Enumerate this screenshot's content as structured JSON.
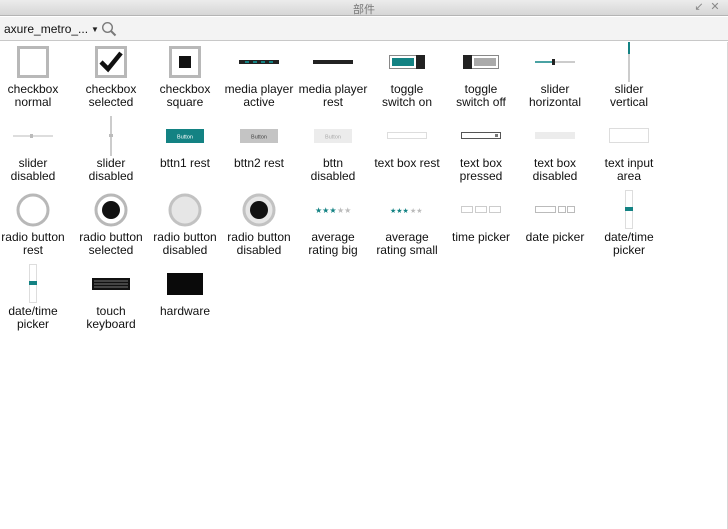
{
  "window": {
    "title": "部件"
  },
  "toolbar": {
    "library_select": "axure_metro_...",
    "search_icon": "search-icon"
  },
  "widgets": [
    {
      "id": "checkbox-normal",
      "line1": "checkbox",
      "line2": "normal"
    },
    {
      "id": "checkbox-selected",
      "line1": "checkbox",
      "line2": "selected"
    },
    {
      "id": "checkbox-square",
      "line1": "checkbox",
      "line2": "square"
    },
    {
      "id": "media-player-active",
      "line1": "media player",
      "line2": "active"
    },
    {
      "id": "media-player-rest",
      "line1": "media player",
      "line2": "rest"
    },
    {
      "id": "toggle-switch-on",
      "line1": "toggle",
      "line2": "switch on"
    },
    {
      "id": "toggle-switch-off",
      "line1": "toggle",
      "line2": "switch off"
    },
    {
      "id": "slider-horizontal",
      "line1": "slider",
      "line2": "horizontal"
    },
    {
      "id": "slider-vertical",
      "line1": "slider",
      "line2": "vertical"
    },
    {
      "id": "slider-disabled-h",
      "line1": "slider",
      "line2": "disabled"
    },
    {
      "id": "slider-disabled-v",
      "line1": "slider",
      "line2": "disabled"
    },
    {
      "id": "bttn1-rest",
      "line1": "bttn1 rest",
      "line2": "",
      "thumb_text": "Button"
    },
    {
      "id": "bttn2-rest",
      "line1": "bttn2 rest",
      "line2": "",
      "thumb_text": "Button"
    },
    {
      "id": "bttn-disabled",
      "line1": "bttn",
      "line2": "disabled",
      "thumb_text": "Button"
    },
    {
      "id": "text-box-rest",
      "line1": "text box rest",
      "line2": ""
    },
    {
      "id": "text-box-pressed",
      "line1": "text box",
      "line2": "pressed"
    },
    {
      "id": "text-box-disabled",
      "line1": "text box",
      "line2": "disabled"
    },
    {
      "id": "text-input-area",
      "line1": "text input",
      "line2": "area"
    },
    {
      "id": "radio-button-rest",
      "line1": "radio button",
      "line2": "rest"
    },
    {
      "id": "radio-button-selected",
      "line1": "radio button",
      "line2": "selected"
    },
    {
      "id": "radio-button-disabled",
      "line1": "radio button",
      "line2": "disabled"
    },
    {
      "id": "radio-button-disabled-selected",
      "line1": "radio button",
      "line2": "disabled"
    },
    {
      "id": "average-rating-big",
      "line1": "average",
      "line2": "rating big"
    },
    {
      "id": "average-rating-small",
      "line1": "average",
      "line2": "rating small"
    },
    {
      "id": "time-picker",
      "line1": "time picker",
      "line2": ""
    },
    {
      "id": "date-picker",
      "line1": "date picker",
      "line2": ""
    },
    {
      "id": "date-time-picker-1",
      "line1": "date/time",
      "line2": "picker"
    },
    {
      "id": "date-time-picker-2",
      "line1": "date/time",
      "line2": "picker"
    },
    {
      "id": "touch-keyboard",
      "line1": "touch",
      "line2": "keyboard"
    },
    {
      "id": "hardware",
      "line1": "hardware",
      "line2": ""
    }
  ],
  "colors": {
    "accent": "#138283",
    "accent_light": "#4aa2a3"
  }
}
